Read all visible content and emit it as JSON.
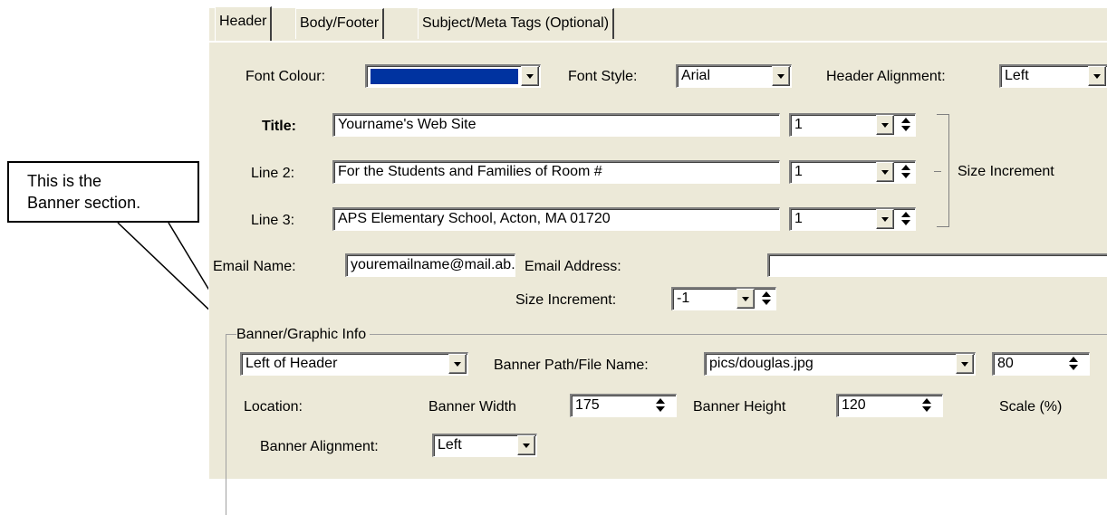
{
  "callout": {
    "line1": "This is the",
    "line2": "Banner section."
  },
  "tabs": [
    {
      "label": "Header"
    },
    {
      "label": "Body/Footer"
    },
    {
      "label": "Subject/Meta Tags (Optional)"
    }
  ],
  "font": {
    "colour_label": "Font Colour:",
    "colour_value": "#0033a0",
    "style_label": "Font Style:",
    "style_value": "Arial",
    "alignment_label": "Header Alignment:",
    "alignment_value": "Left"
  },
  "title_row": {
    "label": "Title:",
    "value": "Yourname's Web Site",
    "size": "1"
  },
  "line2_row": {
    "label": "Line 2:",
    "value": "For the Students and Families of Room #",
    "size": "1"
  },
  "line3_row": {
    "label": "Line 3:",
    "value": "APS Elementary School, Acton, MA 01720",
    "size": "1"
  },
  "size_increment_label": "Size Increment",
  "email": {
    "name_label": "Email Name:",
    "name_value": "youremailname@mail.ab.mec",
    "address_label": "Email Address:",
    "address_value": "",
    "size_label": "Size Increment:",
    "size_value": "-1"
  },
  "banner": {
    "group_label": "Banner/Graphic Info",
    "location_value": "Left of Header",
    "location_label": "Location:",
    "path_label": "Banner Path/File Name:",
    "path_value": "pics/douglas.jpg",
    "scale_value": "80",
    "scale_label": "Scale (%)",
    "width_label": "Banner Width",
    "width_value": "175",
    "height_label": "Banner Height",
    "height_value": "120",
    "alignment_label": "Banner Alignment:",
    "alignment_value": "Left"
  }
}
